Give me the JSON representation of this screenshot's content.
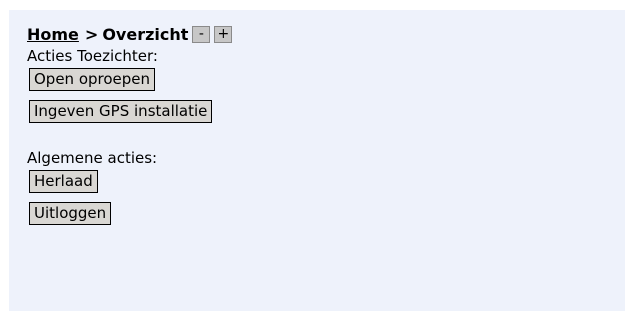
{
  "breadcrumb": {
    "home_label": "Home",
    "separator": ">",
    "current_label": "Overzicht",
    "zoom_out_label": "-",
    "zoom_in_label": "+"
  },
  "supervisor_actions": {
    "label": "Acties Toezichter:",
    "buttons": [
      "Open oproepen",
      "Ingeven GPS installatie"
    ]
  },
  "general_actions": {
    "label": "Algemene acties:",
    "buttons": [
      "Herlaad",
      "Uitloggen"
    ]
  },
  "colors": {
    "panel_background": "#eef2fb",
    "button_background": "#d9d7d3",
    "zoom_button_background": "#c7c7c7"
  }
}
